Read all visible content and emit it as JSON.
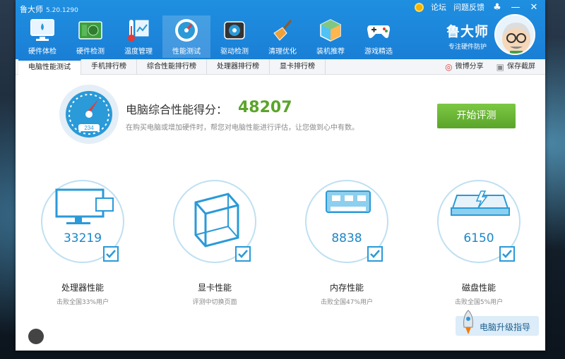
{
  "app": {
    "title": "鲁大师",
    "version": "5.20.1290"
  },
  "window_links": {
    "forum": "论坛",
    "feedback": "问题反馈"
  },
  "toolbar": {
    "items": [
      {
        "label": "硬件体检",
        "icon": "monitor-health-icon"
      },
      {
        "label": "硬件检测",
        "icon": "circuit-board-icon"
      },
      {
        "label": "温度管理",
        "icon": "thermometer-chart-icon"
      },
      {
        "label": "性能测试",
        "icon": "speed-gauge-icon"
      },
      {
        "label": "驱动检测",
        "icon": "gear-chip-icon"
      },
      {
        "label": "清理优化",
        "icon": "broom-icon"
      },
      {
        "label": "装机推荐",
        "icon": "cube-icon"
      },
      {
        "label": "游戏精选",
        "icon": "gamepad-icon"
      }
    ],
    "active_index": 3
  },
  "brand": {
    "name": "鲁大师",
    "slogan": "专注硬件防护"
  },
  "tabs": [
    {
      "label": "电脑性能测试"
    },
    {
      "label": "手机排行榜"
    },
    {
      "label": "综合性能排行榜"
    },
    {
      "label": "处理器排行榜"
    },
    {
      "label": "显卡排行榜"
    }
  ],
  "share": {
    "weibo": "微博分享",
    "screenshot": "保存截屏"
  },
  "score": {
    "title": "电脑综合性能得分：",
    "value": "48207",
    "subtitle": "在购买电脑或增加硬件时，帮您对电脑性能进行评估，让您做到心中有数。",
    "gauge_reading": "234",
    "start_button": "开始评测"
  },
  "cards": [
    {
      "value": "33219",
      "name": "处理器性能",
      "sub": "击败全国33%用户",
      "icon": "cpu-monitor-icon"
    },
    {
      "value": "",
      "name": "显卡性能",
      "sub": "评测中切换页面",
      "icon": "3d-cube-icon"
    },
    {
      "value": "8838",
      "name": "内存性能",
      "sub": "击败全国47%用户",
      "icon": "memory-chip-icon"
    },
    {
      "value": "6150",
      "name": "磁盘性能",
      "sub": "击败全国5%用户",
      "icon": "hard-disk-icon"
    }
  ],
  "upgrade": {
    "label": "电脑升级指导"
  },
  "colors": {
    "title_blue": "#1a7fd6",
    "score_green": "#5aa52a",
    "accent_blue": "#2a9ad8"
  }
}
